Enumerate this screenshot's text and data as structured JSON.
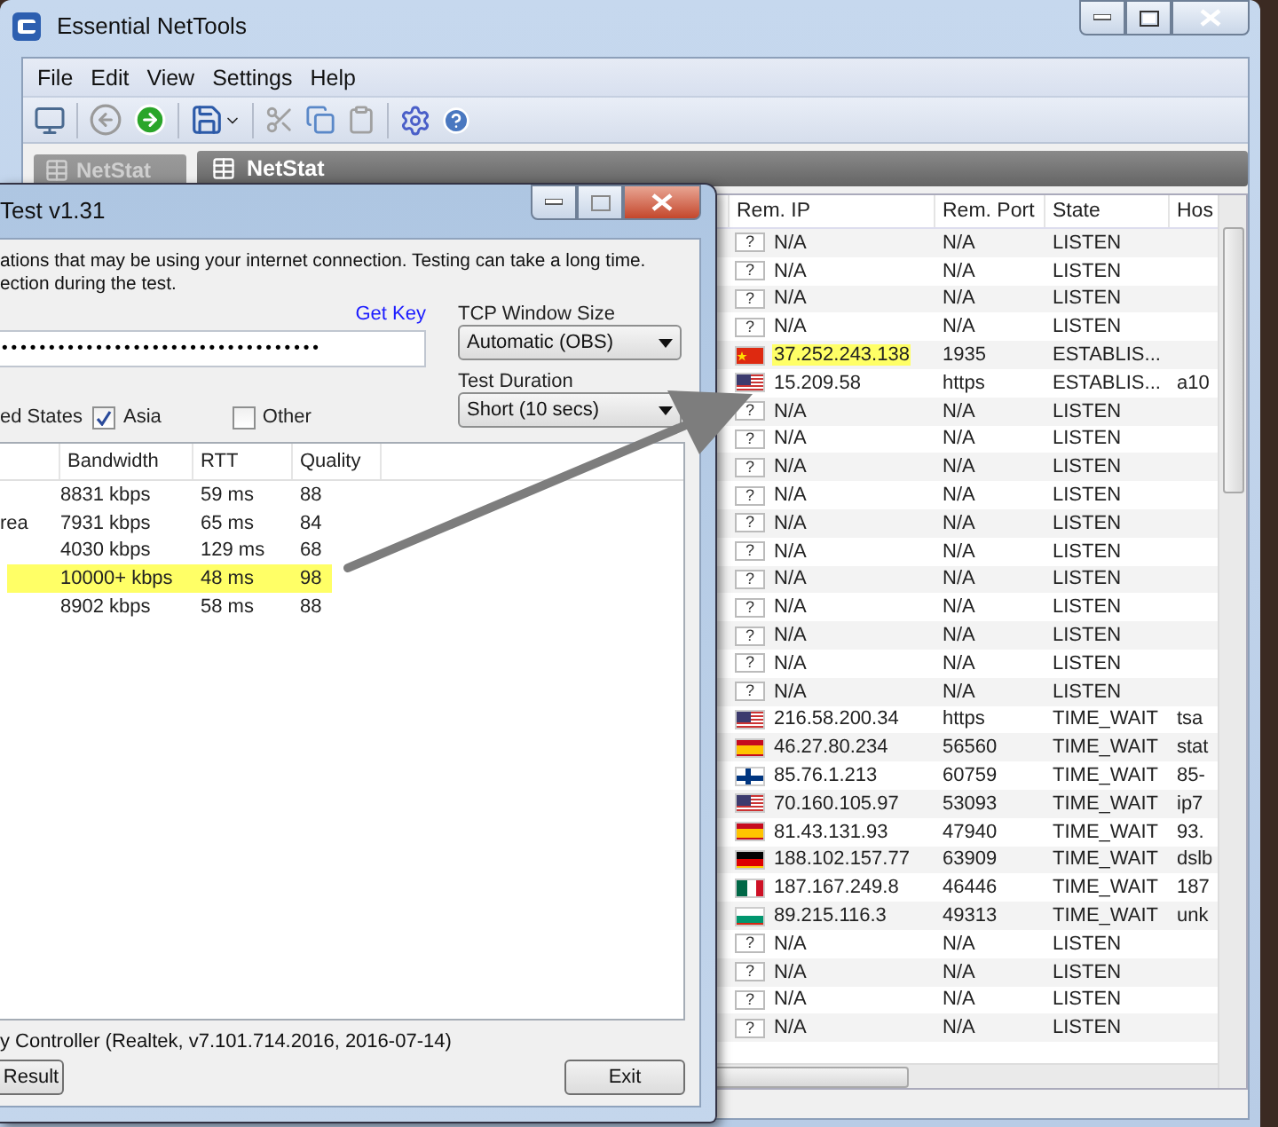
{
  "window": {
    "title": "Essential NetTools"
  },
  "menu": [
    "File",
    "Edit",
    "View",
    "Settings",
    "Help"
  ],
  "sidebar": {
    "items": [
      "NetStat"
    ]
  },
  "panel": {
    "title": "NetStat"
  },
  "table": {
    "columns": [
      "Rem. IP",
      "Rem. Port",
      "State",
      "Hos"
    ],
    "rows": [
      {
        "flag_text": "?",
        "ip": "N/A",
        "port": "N/A",
        "state": "LISTEN",
        "highlighted": false
      },
      {
        "flag_text": "?",
        "ip": "N/A",
        "port": "N/A",
        "state": "LISTEN",
        "highlighted": false
      },
      {
        "flag_text": "?",
        "ip": "N/A",
        "port": "N/A",
        "state": "LISTEN",
        "highlighted": false
      },
      {
        "flag_text": "?",
        "ip": "N/A",
        "port": "N/A",
        "state": "LISTEN",
        "highlighted": false
      },
      {
        "kind": "cn",
        "ip": "37.252.243.138",
        "port": "1935",
        "state": "ESTABLIS...",
        "highlighted": true
      },
      {
        "kind": "us",
        "ip": "15.209.58",
        "port": "https",
        "state": "ESTABLIS...",
        "host": "a10",
        "highlighted": false
      },
      {
        "flag_text": "?",
        "ip": "N/A",
        "port": "N/A",
        "state": "LISTEN",
        "highlighted": false
      },
      {
        "flag_text": "?",
        "ip": "N/A",
        "port": "N/A",
        "state": "LISTEN",
        "highlighted": false
      },
      {
        "flag_text": "?",
        "ip": "N/A",
        "port": "N/A",
        "state": "LISTEN",
        "highlighted": false
      },
      {
        "flag_text": "?",
        "ip": "N/A",
        "port": "N/A",
        "state": "LISTEN",
        "highlighted": false
      },
      {
        "flag_text": "?",
        "ip": "N/A",
        "port": "N/A",
        "state": "LISTEN",
        "highlighted": false
      },
      {
        "flag_text": "?",
        "ip": "N/A",
        "port": "N/A",
        "state": "LISTEN",
        "highlighted": false
      },
      {
        "flag_text": "?",
        "ip": "N/A",
        "port": "N/A",
        "state": "LISTEN",
        "highlighted": false
      },
      {
        "flag_text": "?",
        "ip": "N/A",
        "port": "N/A",
        "state": "LISTEN",
        "highlighted": false
      },
      {
        "flag_text": "?",
        "ip": "N/A",
        "port": "N/A",
        "state": "LISTEN",
        "highlighted": false
      },
      {
        "flag_text": "?",
        "ip": "N/A",
        "port": "N/A",
        "state": "LISTEN",
        "highlighted": false
      },
      {
        "flag_text": "?",
        "ip": "N/A",
        "port": "N/A",
        "state": "LISTEN",
        "highlighted": false
      },
      {
        "kind": "us",
        "ip": "216.58.200.34",
        "port": "https",
        "state": "TIME_WAIT",
        "host": "tsa",
        "highlighted": false
      },
      {
        "kind": "es",
        "ip": "46.27.80.234",
        "port": "56560",
        "state": "TIME_WAIT",
        "host": "stat",
        "highlighted": false
      },
      {
        "kind": "fi",
        "ip": "85.76.1.213",
        "port": "60759",
        "state": "TIME_WAIT",
        "host": "85-",
        "highlighted": false
      },
      {
        "kind": "us",
        "ip": "70.160.105.97",
        "port": "53093",
        "state": "TIME_WAIT",
        "host": "ip7",
        "highlighted": false
      },
      {
        "kind": "es",
        "ip": "81.43.131.93",
        "port": "47940",
        "state": "TIME_WAIT",
        "host": "93.",
        "highlighted": false
      },
      {
        "kind": "de",
        "ip": "188.102.157.77",
        "port": "63909",
        "state": "TIME_WAIT",
        "host": "dslb",
        "highlighted": false
      },
      {
        "kind": "mx",
        "ip": "187.167.249.8",
        "port": "46446",
        "state": "TIME_WAIT",
        "host": "187",
        "highlighted": false
      },
      {
        "kind": "bg",
        "ip": "89.215.116.3",
        "port": "49313",
        "state": "TIME_WAIT",
        "host": "unk",
        "highlighted": false
      },
      {
        "flag_text": "?",
        "ip": "N/A",
        "port": "N/A",
        "state": "LISTEN",
        "highlighted": false
      },
      {
        "flag_text": "?",
        "ip": "N/A",
        "port": "N/A",
        "state": "LISTEN",
        "highlighted": false
      },
      {
        "flag_text": "?",
        "ip": "N/A",
        "port": "N/A",
        "state": "LISTEN",
        "highlighted": false
      },
      {
        "flag_text": "?",
        "ip": "N/A",
        "port": "N/A",
        "state": "LISTEN",
        "highlighted": false
      }
    ]
  },
  "dialog": {
    "title": "Test v1.31",
    "notice": [
      "ations that may be using your internet connection. Testing can take a long time.",
      "ection during the test."
    ],
    "get_key": "Get Key",
    "key_field": {
      "value": "••••••••••••••••••••••••••••••••••"
    },
    "tcp_window": {
      "label": "TCP Window Size",
      "value": "Automatic (OBS)"
    },
    "duration": {
      "label": "Test Duration",
      "value": "Short (10 secs)"
    },
    "region_cut": "ed States",
    "regions": [
      {
        "label": "Asia",
        "checked": true
      },
      {
        "label": "Other",
        "checked": false
      }
    ],
    "results": {
      "columns": [
        "Bandwidth",
        "RTT",
        "Quality"
      ],
      "rows": [
        {
          "bandwidth": "8831 kbps",
          "rtt": "59 ms",
          "quality": "88",
          "highlighted": false
        },
        {
          "region": "rea",
          "bandwidth": "7931 kbps",
          "rtt": "65 ms",
          "quality": "84",
          "highlighted": false
        },
        {
          "bandwidth": "4030 kbps",
          "rtt": "129 ms",
          "quality": "68",
          "highlighted": false
        },
        {
          "bandwidth": "10000+ kbps",
          "rtt": "48 ms",
          "quality": "98",
          "highlighted": true
        },
        {
          "bandwidth": "8902 kbps",
          "rtt": "58 ms",
          "quality": "88",
          "highlighted": false
        }
      ]
    },
    "status": "y Controller (Realtek, v7.101.714.2016, 2016-07-14)",
    "buttons": [
      "Result",
      "Exit"
    ]
  }
}
